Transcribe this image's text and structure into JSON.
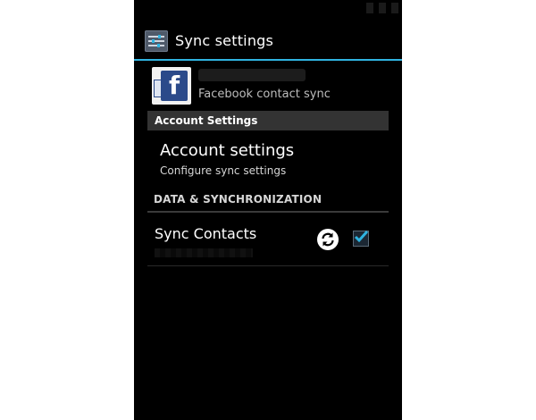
{
  "action_bar": {
    "title": "Sync settings",
    "icon": "settings-sliders-icon"
  },
  "account": {
    "logo": "facebook-logo",
    "subtitle": "Facebook contact sync"
  },
  "section_account": {
    "label": "Account Settings"
  },
  "account_settings_item": {
    "title": "Account settings",
    "summary": "Configure sync settings"
  },
  "section_data": {
    "label": "DATA & SYNCHRONIZATION"
  },
  "sync_contacts": {
    "title": "Sync Contacts",
    "sync_icon": "sync-refresh-icon",
    "checked": true
  },
  "colors": {
    "accent": "#2fb3e0",
    "background": "#000000",
    "section_bar": "#333333"
  }
}
